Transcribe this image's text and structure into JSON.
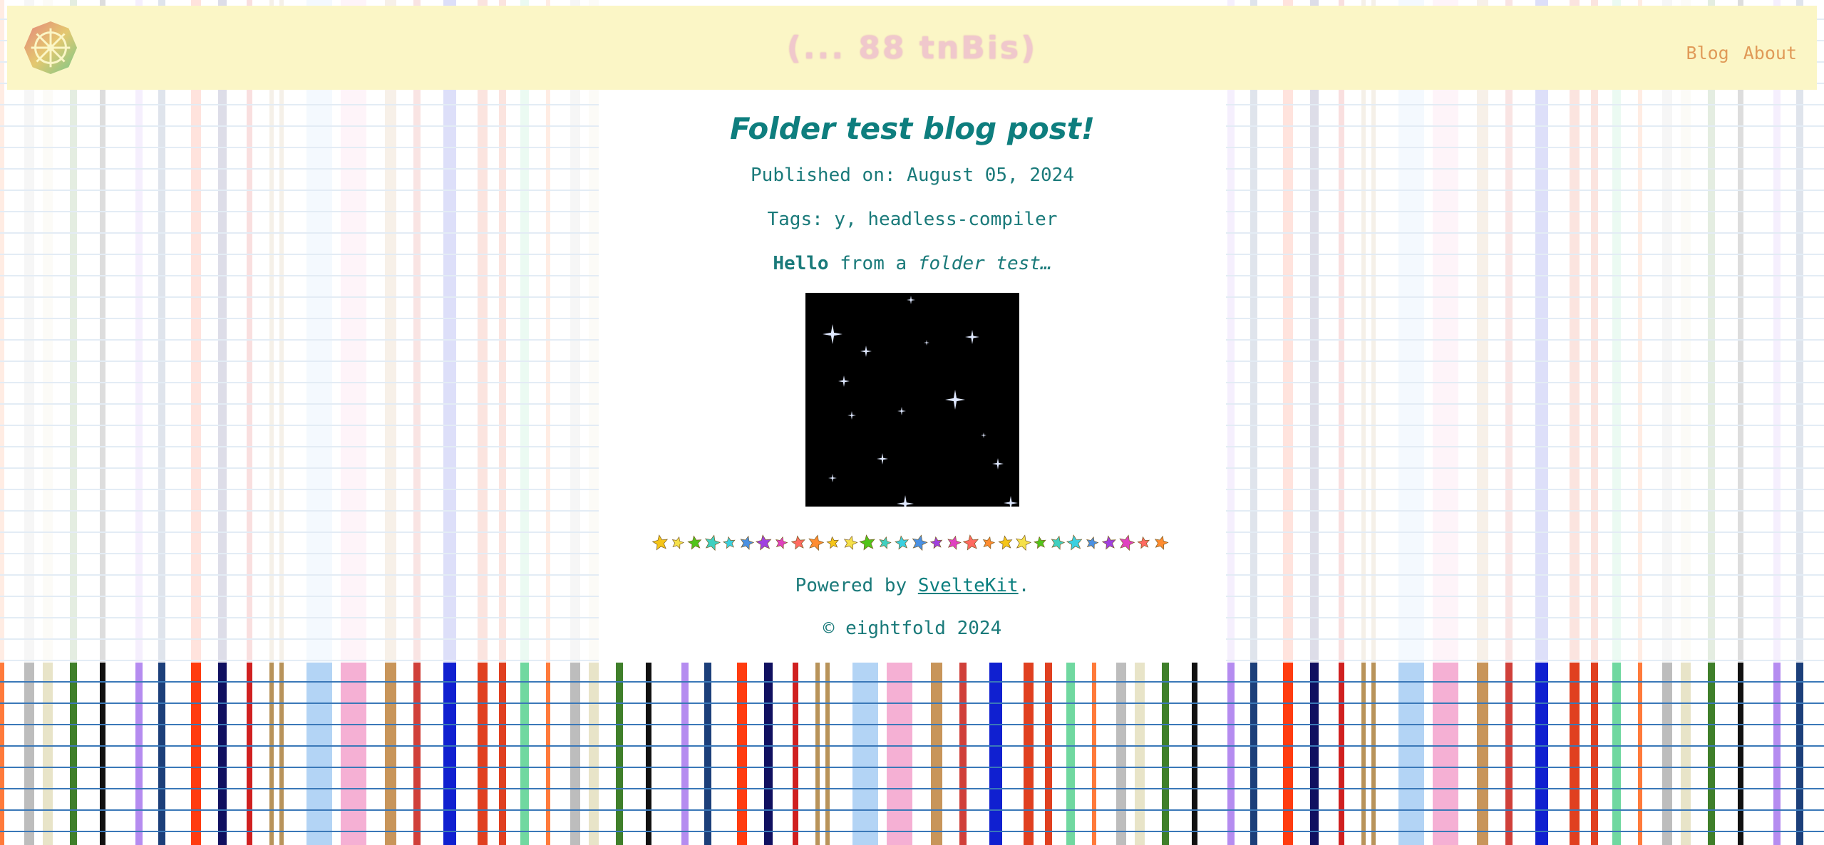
{
  "header": {
    "site_title": "(... 88 tnBis)",
    "nav": [
      {
        "label": "Blog"
      },
      {
        "label": "About"
      }
    ]
  },
  "post": {
    "title": "Folder test blog post!",
    "published_prefix": "Published on:",
    "published_date": "August 05, 2024",
    "tags_prefix": "Tags:",
    "tags": "y, headless-compiler",
    "hello_bold": "Hello",
    "hello_middle": " from a ",
    "hello_italic": "folder test…"
  },
  "footer": {
    "powered_prefix": "Powered by ",
    "powered_link": "SvelteKit",
    "powered_suffix": ".",
    "copyright": "© eightfold 2024"
  },
  "colors": {
    "accent": "#0e7e7e",
    "header_bg": "#fbf6c6",
    "nav_link": "#e09a58",
    "star_colors": [
      "#f5c518",
      "#f5e04a",
      "#52c41a",
      "#40d0c0",
      "#3ad0e0",
      "#4a90e2",
      "#a040e0",
      "#e040c0",
      "#ff6a60",
      "#ff8c30"
    ]
  },
  "icons": {
    "logo": "ship-wheel-icon",
    "image": "starfield-image",
    "divider": "star-divider-icon"
  }
}
